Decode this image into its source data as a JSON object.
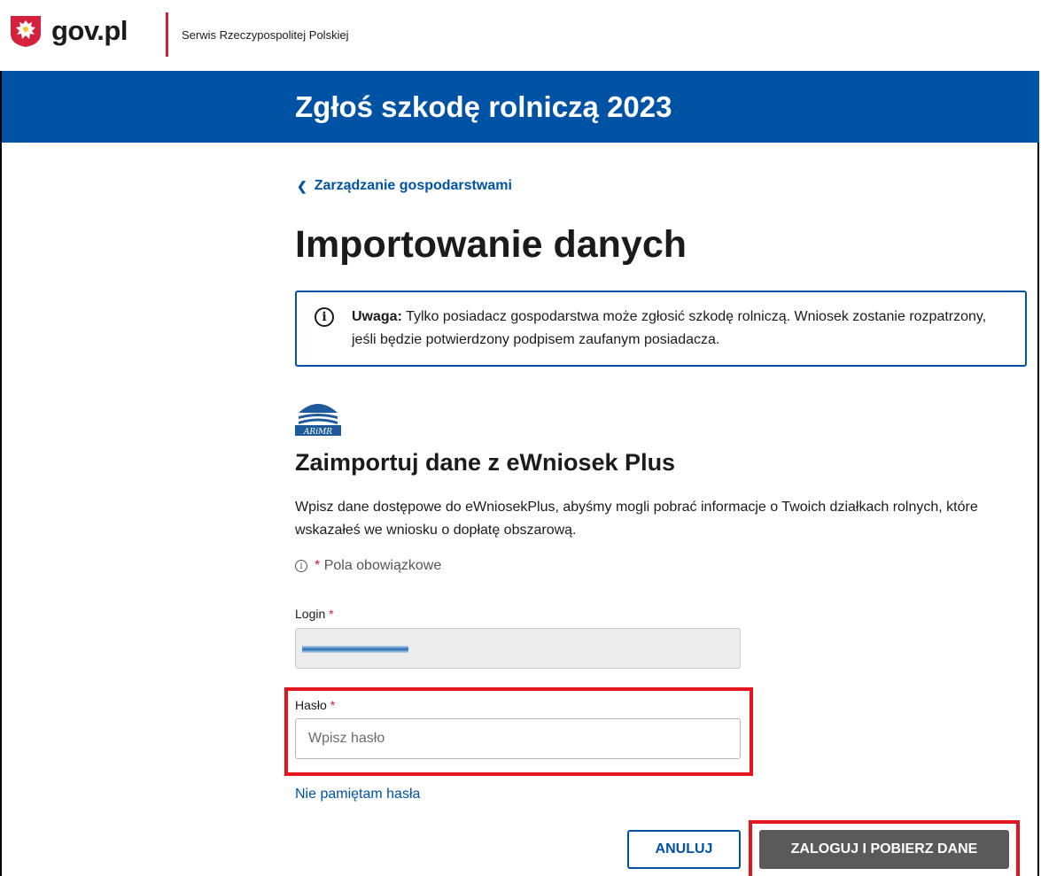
{
  "header": {
    "logo_text": "gov.pl",
    "service_name": "Serwis Rzeczypospolitej Polskiej"
  },
  "banner": {
    "title": "Zgłoś szkodę rolniczą 2023"
  },
  "nav": {
    "back_link": "Zarządzanie gospodarstwami"
  },
  "page": {
    "title": "Importowanie danych"
  },
  "notice": {
    "label": "Uwaga:",
    "text": " Tylko posiadacz gospodarstwa może zgłosić szkodę rolniczą. Wniosek zostanie rozpatrzony, jeśli będzie potwierdzony podpisem zaufanym posiadacza."
  },
  "import": {
    "logo_text": "ARiMR",
    "title": "Zaimportuj dane z eWniosek Plus",
    "description": "Wpisz dane dostępowe do eWniosekPlus, abyśmy mogli pobrać informacje o Twoich działkach rolnych, które wskazałeś we wniosku o dopłatę obszarową.",
    "required_star": "*",
    "required_note": "Pola obowiązkowe"
  },
  "form": {
    "login_label": "Login",
    "password_label": "Hasło",
    "password_placeholder": "Wpisz hasło",
    "required_star": "*",
    "forgot_password": "Nie pamiętam hasła"
  },
  "actions": {
    "cancel": "ANULUJ",
    "submit": "ZALOGUJ I POBIERZ DANE"
  },
  "colors": {
    "primary": "#0052a5",
    "accent_red": "#d4213d",
    "highlight_red": "#e3161f",
    "submit_bg": "#5a5a5a"
  }
}
